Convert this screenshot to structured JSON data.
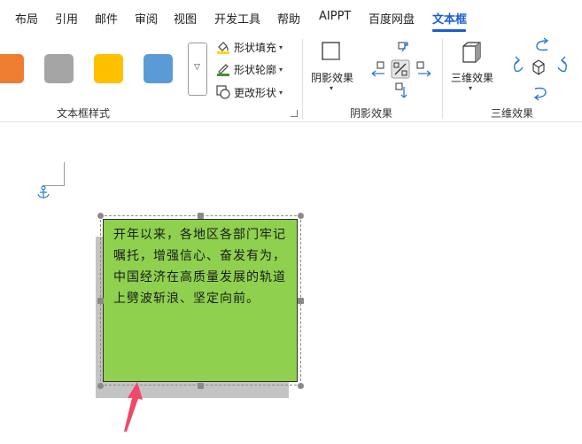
{
  "tabs": [
    {
      "label": "布局"
    },
    {
      "label": "引用"
    },
    {
      "label": "邮件"
    },
    {
      "label": "审阅"
    },
    {
      "label": "视图"
    },
    {
      "label": "开发工具"
    },
    {
      "label": "帮助"
    },
    {
      "label": "AIPPT"
    },
    {
      "label": "百度网盘"
    },
    {
      "label": "文本框",
      "active": true
    }
  ],
  "ribbon": {
    "textbox_styles": {
      "swatches": [
        "#ed7d31",
        "#a5a5a5",
        "#ffc000",
        "#5b9bd5"
      ],
      "fill": "形状填充",
      "outline": "形状轮廓",
      "change_shape": "更改形状",
      "group_label": "文本框样式"
    },
    "shadow": {
      "button": "阴影效果",
      "group_label": "阴影效果"
    },
    "threed": {
      "button": "三维效果",
      "group_label": "三维效果"
    }
  },
  "document": {
    "textbox_text": "开年以来，各地区各部门牢记嘱托，增强信心、奋发有为，中国经济在高质量发展的轨道上劈波斩浪、坚定向前。",
    "textbox_fill": "#8fd14f",
    "shadow_color": "#c4c4c4",
    "arrow_color": "#f0486a"
  }
}
